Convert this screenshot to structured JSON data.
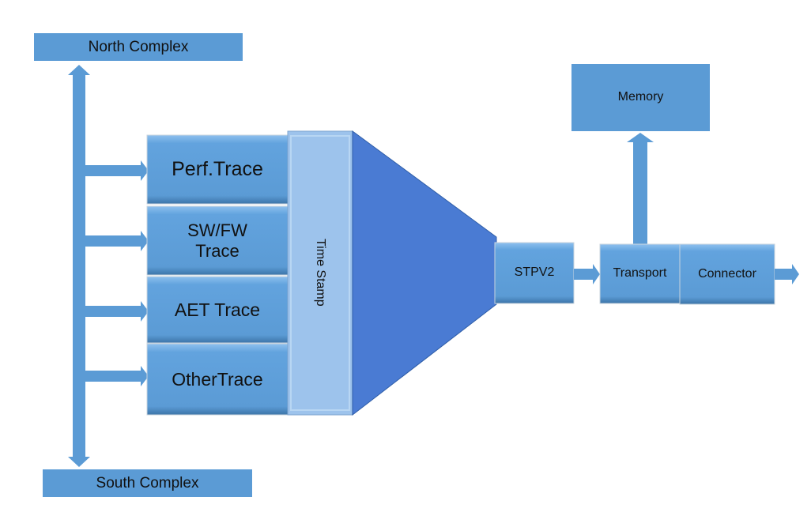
{
  "diagram": {
    "north_complex": "North Complex",
    "south_complex": "South Complex",
    "traces": [
      "Perf.Trace",
      "SW/FW Trace",
      "AET Trace",
      "OtherTrace"
    ],
    "time_stamp": "Time Stamp",
    "stpv2": "STPV2",
    "transport": "Transport",
    "connector": "Connector",
    "memory": "Memory"
  },
  "colors": {
    "box": "#5b9bd5",
    "block": "#5fa0dc",
    "time_stamp": "#9dc3ec",
    "funnel": "#4a7bd3"
  }
}
